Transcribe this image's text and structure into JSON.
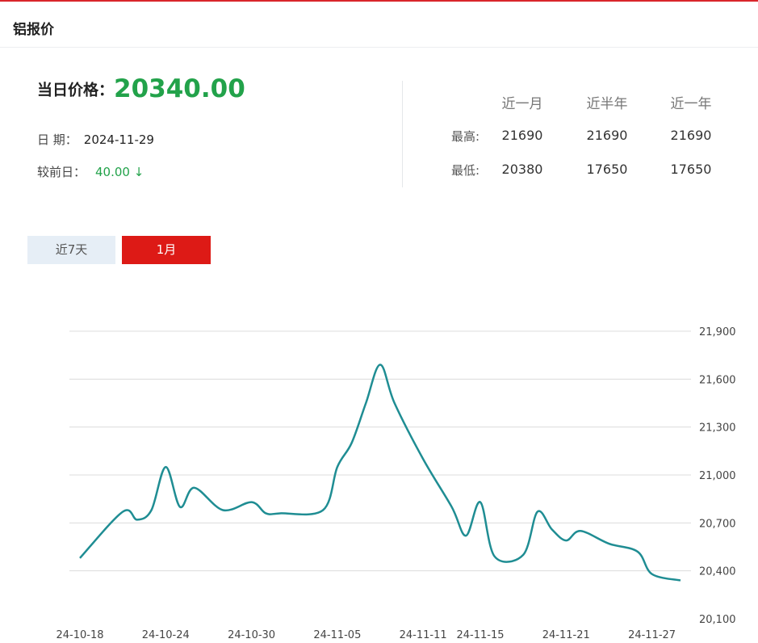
{
  "header": {
    "title": "铝报价"
  },
  "price": {
    "label": "当日价格：",
    "value": "20340.00",
    "date_label": "日 期：",
    "date_value": "2024-11-29",
    "change_label": "较前日：",
    "change_value": "40.00 ↓"
  },
  "stats": {
    "columns": [
      "近一月",
      "近半年",
      "近一年"
    ],
    "rows": [
      {
        "label": "最高:",
        "values": [
          "21690",
          "21690",
          "21690"
        ]
      },
      {
        "label": "最低:",
        "values": [
          "20380",
          "17650",
          "17650"
        ]
      }
    ]
  },
  "tabs": [
    {
      "label": "近7天",
      "active": false
    },
    {
      "label": "1月",
      "active": true
    }
  ],
  "colors": {
    "accent_red": "#dd1a16",
    "price_green": "#22a24a",
    "line": "#1f8d93"
  },
  "chart_data": {
    "type": "line",
    "x": [
      "2024-10-18",
      "2024-10-19",
      "2024-10-20",
      "2024-10-21",
      "2024-10-22",
      "2024-10-23",
      "2024-10-24",
      "2024-10-25",
      "2024-10-26",
      "2024-10-27",
      "2024-10-28",
      "2024-10-29",
      "2024-10-30",
      "2024-10-31",
      "2024-11-01",
      "2024-11-02",
      "2024-11-03",
      "2024-11-04",
      "2024-11-05",
      "2024-11-06",
      "2024-11-07",
      "2024-11-08",
      "2024-11-09",
      "2024-11-10",
      "2024-11-11",
      "2024-11-12",
      "2024-11-13",
      "2024-11-14",
      "2024-11-15",
      "2024-11-16",
      "2024-11-17",
      "2024-11-18",
      "2024-11-19",
      "2024-11-20",
      "2024-11-21",
      "2024-11-22",
      "2024-11-23",
      "2024-11-24",
      "2024-11-25",
      "2024-11-26",
      "2024-11-27",
      "2024-11-28",
      "2024-11-29"
    ],
    "series": [
      {
        "values": [
          20480,
          20770,
          20720,
          20780,
          21050,
          20800,
          20920,
          20780,
          20830,
          20760,
          20760,
          20780,
          21050,
          21200,
          21450,
          21690,
          21450,
          21100,
          20800,
          20620,
          20830,
          20490,
          20500,
          20770,
          20660,
          20590,
          20650,
          20570,
          20520,
          20380,
          20340
        ]
      }
    ],
    "x_tick_labels": [
      "24-10-18",
      "24-10-24",
      "24-10-30",
      "24-11-05",
      "24-11-11",
      "24-11-15",
      "24-11-21",
      "24-11-27"
    ],
    "ylim": [
      20100,
      21900
    ],
    "y_ticks": [
      "20,100",
      "20,400",
      "20,700",
      "21,000",
      "21,300",
      "21,600",
      "21,900"
    ],
    "grid": true
  }
}
